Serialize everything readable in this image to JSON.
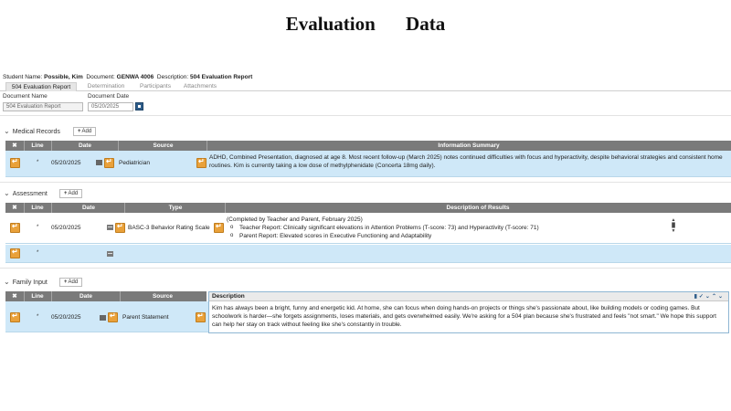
{
  "page_title": "Evaluation Data",
  "student_info": {
    "name_label": "Student Name:",
    "name_value": "Possible, Kim",
    "document_label": "Document:",
    "document_value": "GENWA 4006",
    "description_label": "Description:",
    "description_value": "504 Evaluation Report"
  },
  "tabs": [
    "504 Evaluation Report",
    "Determination",
    "Participants",
    "Attachments"
  ],
  "document": {
    "name_label": "Document Name",
    "name_value": "504 Evaluation Report",
    "date_label": "Document Date",
    "date_value": "05/20/2025"
  },
  "medical_records": {
    "title": "Medical Records",
    "add_label": "Add",
    "columns": [
      "✖",
      "Line",
      "Date",
      "Source",
      "Information Summary"
    ],
    "rows": [
      {
        "line": "*",
        "date": "05/20/2025",
        "source": "Pediatrician",
        "summary": "ADHD, Combined Presentation, diagnosed at age 8. Most recent follow-up (March 2025) notes continued difficulties with focus and hyperactivity, despite behavioral strategies and consistent home routines. Kim is currently taking a low dose of methylphenidate (Concerta 18mg daily)."
      }
    ]
  },
  "assessment": {
    "title": "Assessment",
    "add_label": "Add",
    "columns": [
      "✖",
      "Line",
      "Date",
      "Type",
      "Description of Results"
    ],
    "rows": [
      {
        "line": "*",
        "date": "05/20/2025",
        "type": "BASC-3 Behavior Rating Scale",
        "intro": "(Completed by Teacher and Parent, February 2025)",
        "results": [
          "Teacher Report: Clinically significant elevations in Attention Problems (T-score: 73) and Hyperactivity (T-score: 71)",
          "Parent Report: Elevated scores in Executive Functioning and Adaptability"
        ]
      },
      {
        "line": "*"
      }
    ]
  },
  "family_input": {
    "title": "Family Input",
    "add_label": "Add",
    "columns": [
      "✖",
      "Line",
      "Date",
      "Source"
    ],
    "description_header": "Description",
    "rows": [
      {
        "line": "*",
        "date": "05/20/2025",
        "source": "Parent Statement",
        "description": "Kim has always been a bright, funny and energetic kid. At home, she can focus when doing hands-on projects or things she's passionate about, like building models or coding games. But schoolwork is harder—she forgets assignments, loses materials, and gets overwhelmed easily. We're asking for a 504 plan because she's frustrated and feels \"not smart.\" We hope this support can help her stay on track without feeling like she's constantly in trouble."
      }
    ]
  }
}
